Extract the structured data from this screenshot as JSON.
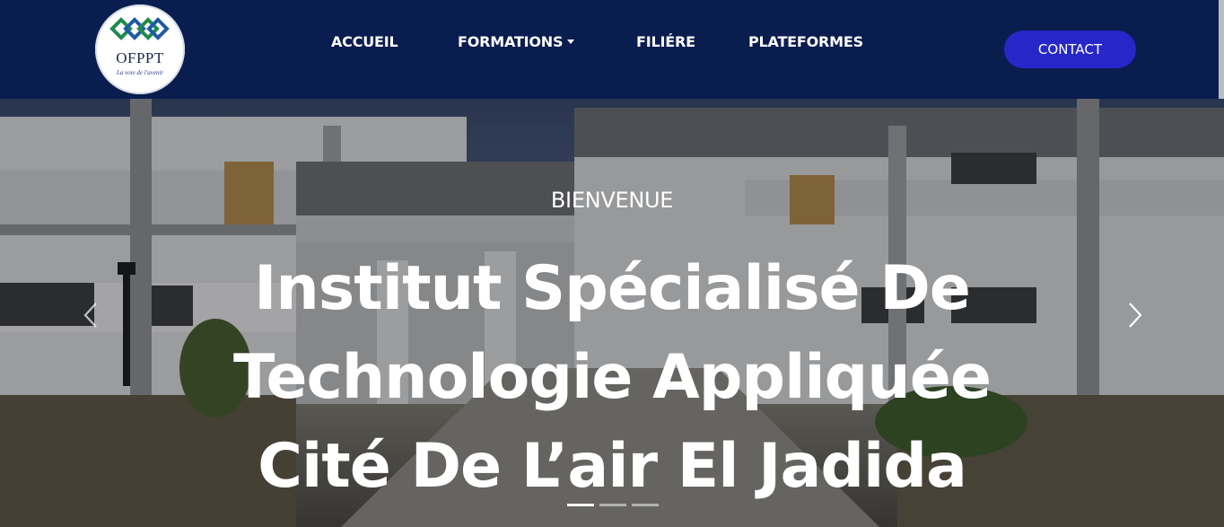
{
  "logo": {
    "name": "OFPPT",
    "tagline": "La voie de l'avenir"
  },
  "nav": {
    "items": [
      {
        "label": "ACCUEIL"
      },
      {
        "label": "FORMATIONS",
        "has_dropdown": true
      },
      {
        "label": "FILIÉRE"
      },
      {
        "label": "PLATEFORMES"
      }
    ],
    "contact_label": "CONTACT"
  },
  "hero": {
    "eyebrow": "BIENVENUE",
    "title_lines": [
      "Institut Spécialisé De",
      "Technologie Appliquée",
      "Cité De L’air El Jadida"
    ],
    "slides_count": 3,
    "active_slide": 1
  },
  "icons": {
    "prev": "chevron-left-icon",
    "next": "chevron-right-icon"
  },
  "colors": {
    "navbar_bg": "#0a1d4f",
    "contact_button": "#2626c9"
  }
}
